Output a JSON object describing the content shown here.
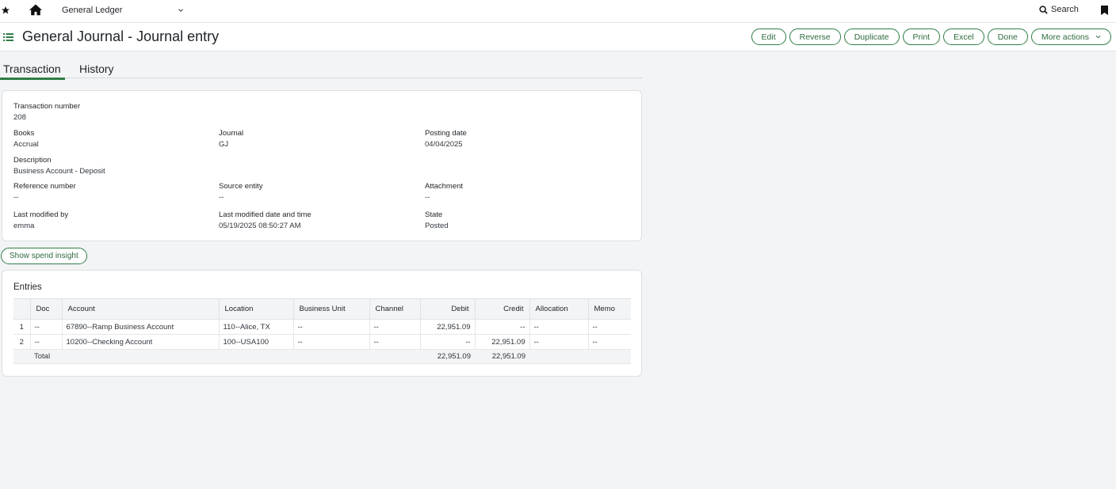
{
  "topbar": {
    "app_name": "General Ledger",
    "search_label": "Search"
  },
  "header": {
    "title": "General Journal - Journal entry",
    "actions": [
      "Edit",
      "Reverse",
      "Duplicate",
      "Print",
      "Excel",
      "Done",
      "More actions"
    ]
  },
  "tabs": [
    "Transaction",
    "History"
  ],
  "details": {
    "transaction_number": {
      "label": "Transaction number",
      "value": "208"
    },
    "books": {
      "label": "Books",
      "value": "Accrual"
    },
    "journal": {
      "label": "Journal",
      "value": "GJ"
    },
    "posting_date": {
      "label": "Posting date",
      "value": "04/04/2025"
    },
    "description": {
      "label": "Description",
      "value": "Business Account - Deposit"
    },
    "reference_number": {
      "label": "Reference number",
      "value": "--"
    },
    "source_entity": {
      "label": "Source entity",
      "value": "--"
    },
    "attachment": {
      "label": "Attachment",
      "value": "--"
    },
    "last_modified_by": {
      "label": "Last modified by",
      "value": "emma"
    },
    "last_modified_date": {
      "label": "Last modified date and time",
      "value": "05/19/2025 08:50:27 AM"
    },
    "state": {
      "label": "State",
      "value": "Posted"
    }
  },
  "spend_insight_label": "Show spend insight",
  "entries": {
    "title": "Entries",
    "columns": [
      "",
      "Doc",
      "Account",
      "Location",
      "Business Unit",
      "Channel",
      "Debit",
      "Credit",
      "Allocation",
      "Memo"
    ],
    "rows": [
      [
        "1",
        "--",
        "67890--Ramp Business Account",
        "110--Alice, TX",
        "--",
        "--",
        "22,951.09",
        "--",
        "--",
        "--"
      ],
      [
        "2",
        "--",
        "10200--Checking Account",
        "100--USA100",
        "--",
        "--",
        "--",
        "22,951.09",
        "--",
        "--"
      ]
    ],
    "total": {
      "label": "Total",
      "debit": "22,951.09",
      "credit": "22,951.09"
    }
  }
}
